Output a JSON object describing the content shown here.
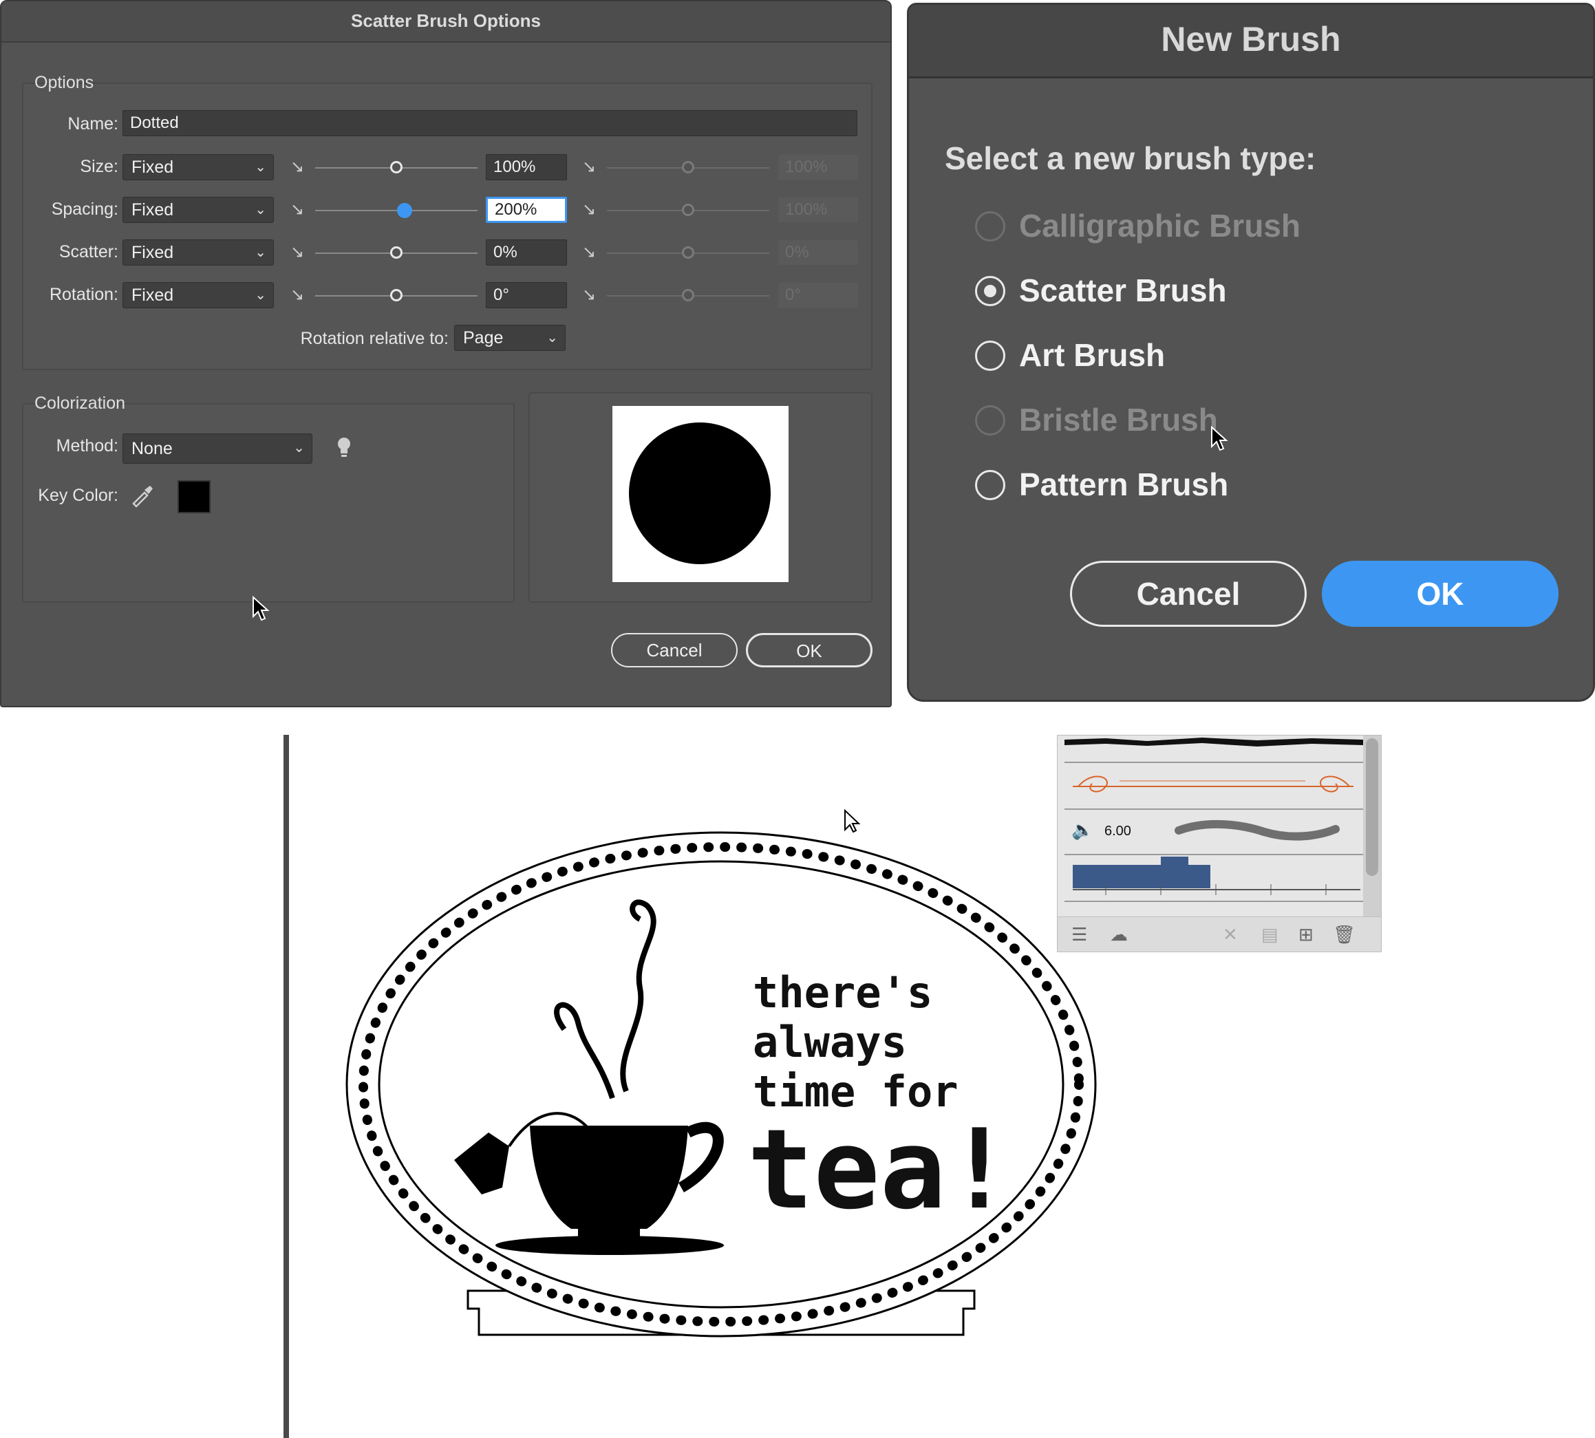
{
  "scatter_dialog": {
    "title": "Scatter Brush Options",
    "options_legend": "Options",
    "name_label": "Name:",
    "name_value": "Dotted",
    "rows": [
      {
        "label": "Size:",
        "mode": "Fixed",
        "value": "100%",
        "value2": "100%",
        "knob_pct": 50
      },
      {
        "label": "Spacing:",
        "mode": "Fixed",
        "value": "200%",
        "value2": "100%",
        "knob_pct": 55
      },
      {
        "label": "Scatter:",
        "mode": "Fixed",
        "value": "0%",
        "value2": "0%",
        "knob_pct": 50
      },
      {
        "label": "Rotation:",
        "mode": "Fixed",
        "value": "0°",
        "value2": "0°",
        "knob_pct": 50
      }
    ],
    "rotation_relative_label": "Rotation relative to:",
    "rotation_relative_value": "Page",
    "colorization_legend": "Colorization",
    "method_label": "Method:",
    "method_value": "None",
    "key_color_label": "Key Color:",
    "key_color": "#000000",
    "cancel_label": "Cancel",
    "ok_label": "OK"
  },
  "new_brush_dialog": {
    "title": "New Brush",
    "prompt": "Select a new brush type:",
    "options": [
      {
        "label": "Calligraphic Brush",
        "enabled": false,
        "selected": false
      },
      {
        "label": "Scatter Brush",
        "enabled": true,
        "selected": true
      },
      {
        "label": "Art Brush",
        "enabled": true,
        "selected": false
      },
      {
        "label": "Bristle Brush",
        "enabled": false,
        "selected": false
      },
      {
        "label": "Pattern Brush",
        "enabled": true,
        "selected": false
      }
    ],
    "cancel_label": "Cancel",
    "ok_label": "OK",
    "accent_color": "#3d97f2"
  },
  "brushes_panel": {
    "bristle_size": "6.00"
  },
  "artwork": {
    "line1": "there's",
    "line2": "always",
    "line3": "time for",
    "line4": "tea!"
  }
}
